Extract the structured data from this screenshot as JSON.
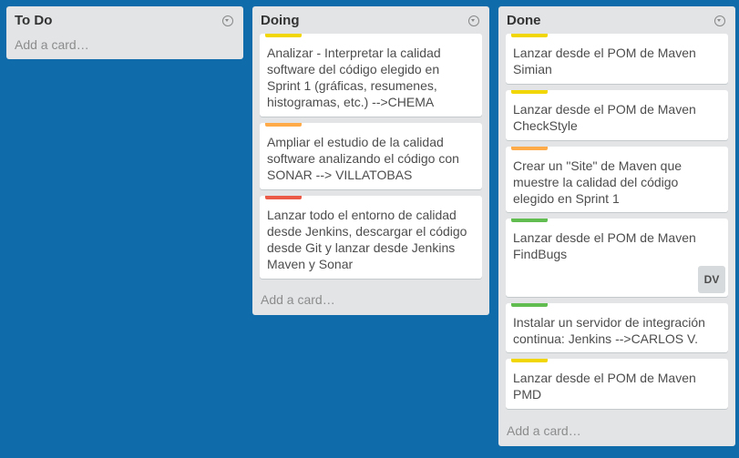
{
  "colors": {
    "board_bg": "#0f6ba9",
    "label_yellow": "#f2d600",
    "label_orange": "#ffab4a",
    "label_red": "#eb5a46",
    "label_green": "#61bd4f"
  },
  "lists": [
    {
      "title": "To Do",
      "add_card": "Add a card…",
      "cards": []
    },
    {
      "title": "Doing",
      "add_card": "Add a card…",
      "cards": [
        {
          "label": "yellow",
          "text": "Analizar - Interpretar la calidad software del código elegido en Sprint 1 (gráficas, resumenes, histogramas, etc.) -->CHEMA"
        },
        {
          "label": "orange",
          "text": "Ampliar el estudio de la calidad software analizando el código con SONAR --> VILLATOBAS"
        },
        {
          "label": "red",
          "text": "Lanzar todo el entorno de calidad desde Jenkins, descargar el código desde Git y lanzar desde Jenkins Maven y Sonar"
        }
      ]
    },
    {
      "title": "Done",
      "add_card": "Add a card…",
      "cards": [
        {
          "label": "yellow",
          "text": "Lanzar desde el POM de Maven Simian"
        },
        {
          "label": "yellow",
          "text": "Lanzar desde el POM de Maven CheckStyle"
        },
        {
          "label": "orange",
          "text": "Crear un \"Site\" de Maven que muestre la calidad del código elegido en Sprint 1"
        },
        {
          "label": "green",
          "text": "Lanzar desde el POM de Maven FindBugs",
          "member": "DV"
        },
        {
          "label": "green",
          "text": "Instalar un servidor de integración continua: Jenkins -->CARLOS V."
        },
        {
          "label": "yellow",
          "text": "Lanzar desde el POM de Maven PMD"
        }
      ]
    }
  ]
}
